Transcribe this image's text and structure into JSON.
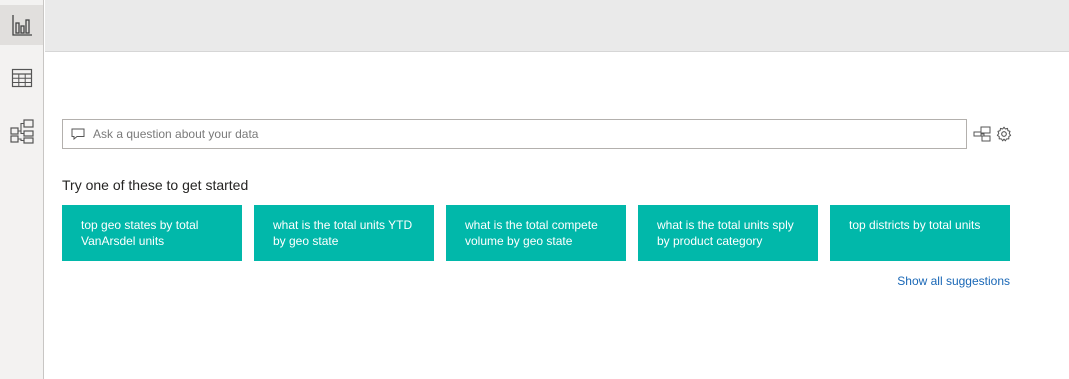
{
  "rail": {
    "items": [
      {
        "name": "report-view",
        "icon": "bar-chart-icon",
        "active": true
      },
      {
        "name": "data-view",
        "icon": "table-icon",
        "active": false
      },
      {
        "name": "model-view",
        "icon": "model-icon",
        "active": false
      }
    ]
  },
  "qa": {
    "placeholder": "Ask a question about your data",
    "value": ""
  },
  "suggestions": {
    "heading": "Try one of these to get started",
    "items": [
      "top geo states by total VanArsdel units",
      "what is the total units YTD by geo state",
      "what is the total compete volume by geo state",
      "what is the total units sply by product category",
      "top districts by total units"
    ],
    "show_all": "Show all suggestions"
  },
  "colors": {
    "accent": "#01b8aa",
    "link": "#1967b6"
  }
}
